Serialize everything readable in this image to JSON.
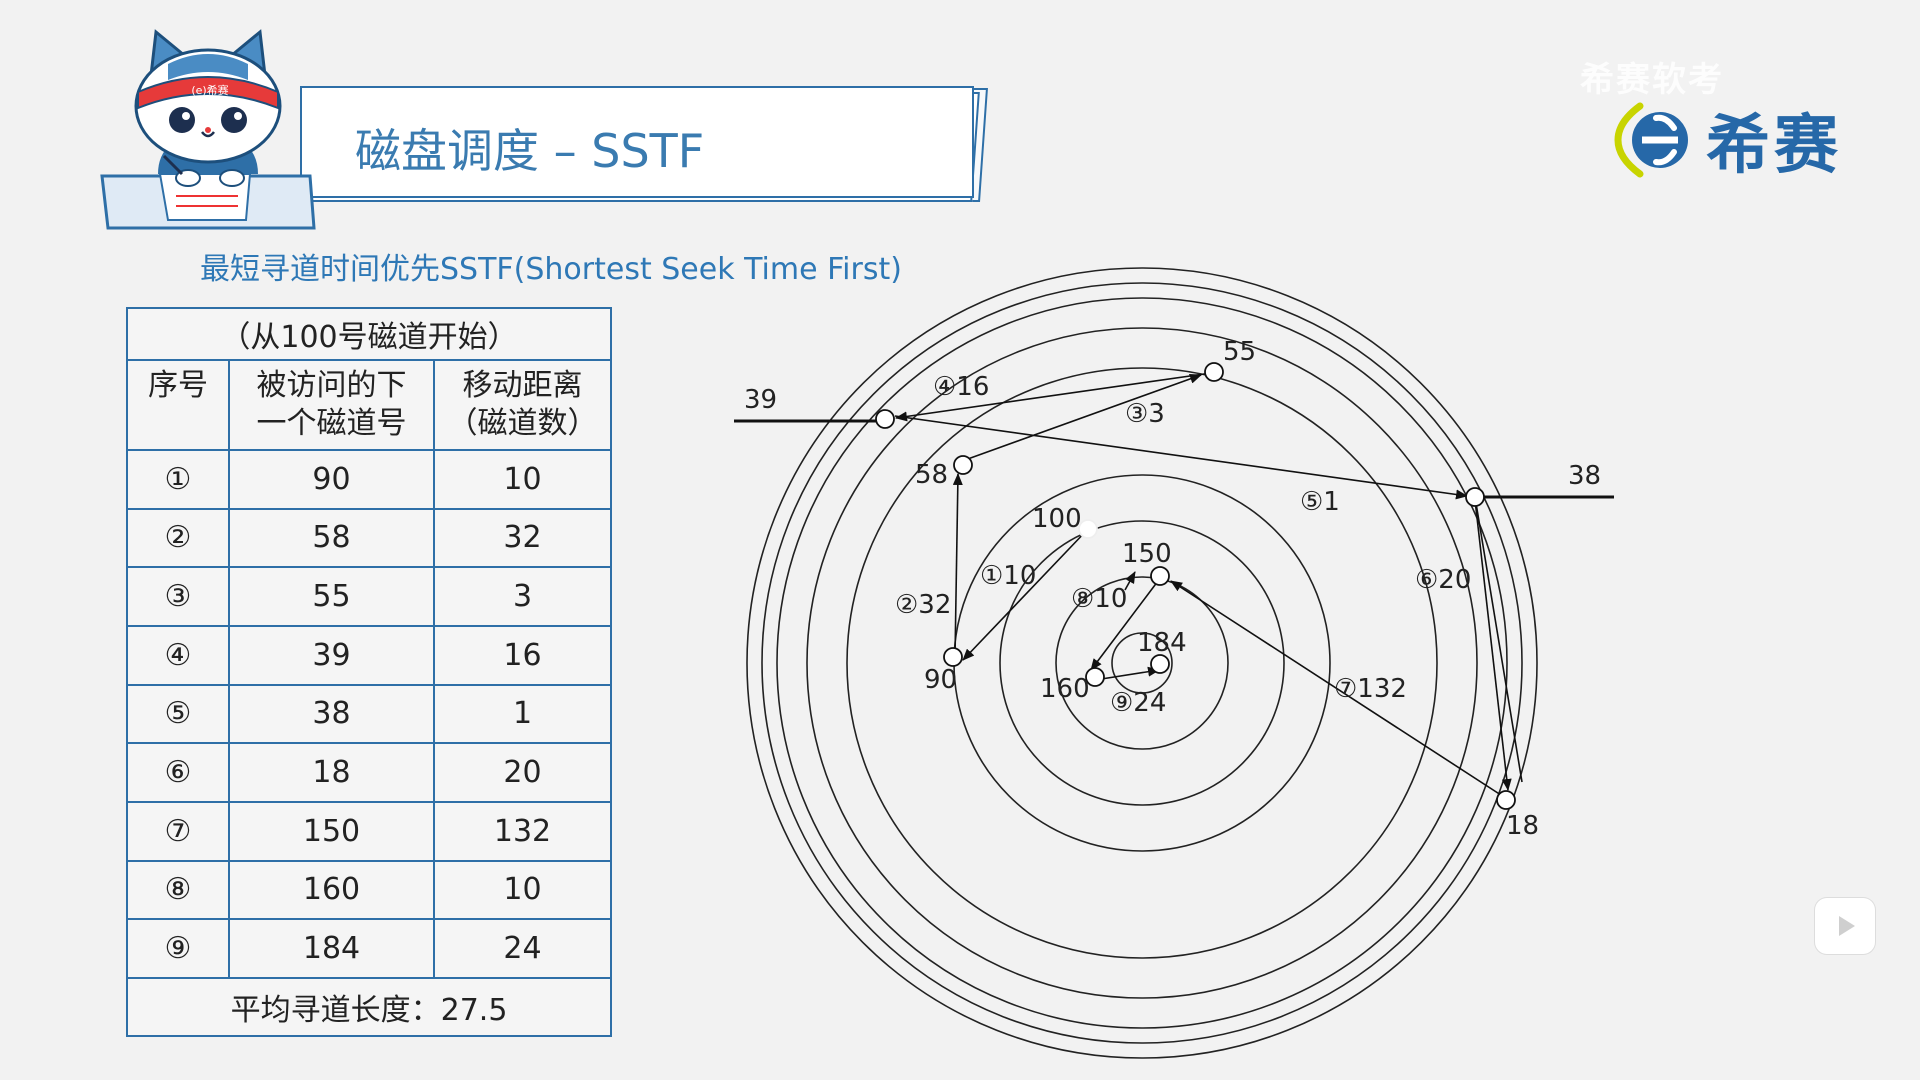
{
  "title": "磁盘调度 – SSTF",
  "subtitle": "最短寻道时间优先SSTF(Shortest Seek Time First)",
  "watermark": "希赛软考",
  "brand": {
    "logo_text": "希赛",
    "mascot_headband": "(e)希赛",
    "color": "#2668a8",
    "accent": "#c8d400"
  },
  "table": {
    "caption": "（从100号磁道开始）",
    "headers": {
      "seq": "序号",
      "track_line1": "被访问的下",
      "track_line2": "一个磁道号",
      "dist_line1": "移动距离",
      "dist_line2": "（磁道数）"
    },
    "rows": [
      {
        "seq": "①",
        "track": "90",
        "dist": "10"
      },
      {
        "seq": "②",
        "track": "58",
        "dist": "32"
      },
      {
        "seq": "③",
        "track": "55",
        "dist": "3"
      },
      {
        "seq": "④",
        "track": "39",
        "dist": "16"
      },
      {
        "seq": "⑤",
        "track": "38",
        "dist": "1"
      },
      {
        "seq": "⑥",
        "track": "18",
        "dist": "20"
      },
      {
        "seq": "⑦",
        "track": "150",
        "dist": "132"
      },
      {
        "seq": "⑧",
        "track": "160",
        "dist": "10"
      },
      {
        "seq": "⑨",
        "track": "184",
        "dist": "24"
      }
    ],
    "footer": "平均寻道长度：27.5"
  },
  "diagram": {
    "track_labels": {
      "t100": "100",
      "t90": "90",
      "t58": "58",
      "t55": "55",
      "t39": "39",
      "t38": "38",
      "t18": "18",
      "t150": "150",
      "t160": "160",
      "t184": "184"
    },
    "move_labels": {
      "m1": "①10",
      "m2": "②32",
      "m3": "③3",
      "m4": "④16",
      "m5": "⑤1",
      "m6": "⑥20",
      "m7": "⑦132",
      "m8": "⑧10",
      "m9": "⑨24"
    }
  }
}
